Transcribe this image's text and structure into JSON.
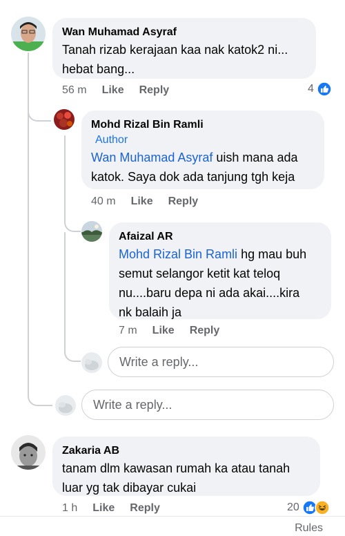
{
  "comments": [
    {
      "author": "Wan Muhamad Asyraf",
      "text_lines": [
        "Tanah rizab kerajaan kaa nak katok2 ni...",
        "hebat bang..."
      ],
      "time": "56 m",
      "like": "Like",
      "reply": "Reply",
      "reaction_count": "4",
      "reaction_icons": [
        "like-reaction-icon"
      ]
    },
    {
      "author": "Mohd Rizal Bin Ramli",
      "badge": "Author",
      "mention": "Wan Muhamad Asyraf",
      "text_first_rest": " uish mana ada",
      "text_lines": [
        "katok. Saya dok ada tanjung tgh keja"
      ],
      "time": "40 m",
      "like": "Like",
      "reply": "Reply"
    },
    {
      "author": "Afaizal AR",
      "mention": "Mohd Rizal Bin Ramli",
      "text_first_rest": " hg mau buh",
      "text_lines": [
        "semut selangor ketit kat teloq",
        "nu....baru depa ni ada akai....kira",
        "nk balaih ja"
      ],
      "time": "7 m",
      "like": "Like",
      "reply": "Reply"
    },
    {
      "author": "Zakaria AB",
      "text_lines": [
        "tanam dlm kawasan rumah ka atau tanah",
        "luar yg tak dibayar cukai"
      ],
      "time": "1 h",
      "like": "Like",
      "reply": "Reply",
      "reaction_count": "20",
      "reaction_icons": [
        "like-reaction-icon",
        "haha-reaction-icon"
      ]
    }
  ],
  "reply_boxes": {
    "nested_placeholder": "Write a reply...",
    "thread_placeholder": "Write a reply..."
  },
  "footer": {
    "rules": "Rules"
  },
  "colors": {
    "mention": "#1b63d2",
    "bubble": "#f0f2f5",
    "meta": "#65676b",
    "like_blue": "#1877f2",
    "haha_yellow": "#f7b125"
  }
}
